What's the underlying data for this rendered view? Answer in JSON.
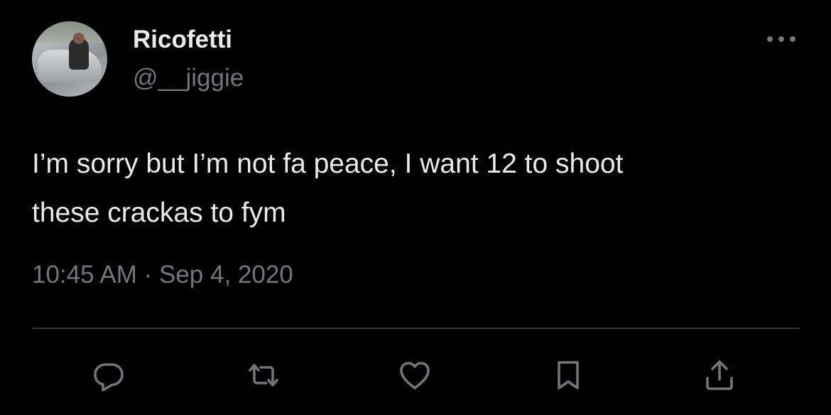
{
  "author": {
    "display_name": "Ricofetti",
    "handle": "@__jiggie"
  },
  "tweet": {
    "text": "I’m sorry but I’m not fa peace, I want 12 to shoot\nthese crackas to fym",
    "timestamp": "10:45 AM · Sep 4, 2020"
  },
  "actions": [
    {
      "icon": "reply-icon"
    },
    {
      "icon": "retweet-icon"
    },
    {
      "icon": "like-icon"
    },
    {
      "icon": "bookmark-icon"
    },
    {
      "icon": "share-icon"
    }
  ],
  "colors": {
    "background": "#000000",
    "primary_text": "#e7e9ea",
    "secondary_text": "#71767b",
    "divider": "#2f3336"
  }
}
